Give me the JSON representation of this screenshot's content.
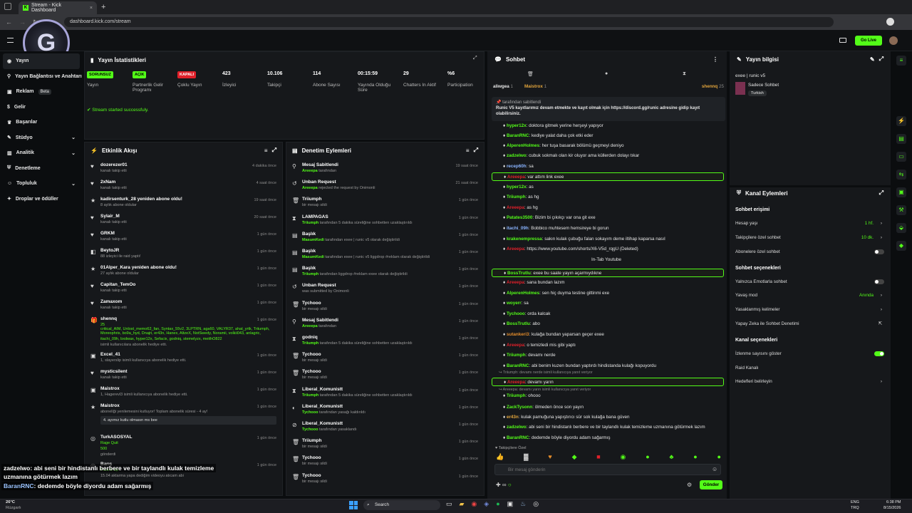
{
  "browser": {
    "tab_title": "Stream - Kick Dashboard",
    "url": "dashboard.kick.com/stream",
    "new_tab": "+"
  },
  "topbar": {
    "go_live": "Go Live"
  },
  "sidebar": {
    "items": [
      {
        "label": "Yayın"
      },
      {
        "label": "Yayın Bağlantısı ve Anahtarı"
      },
      {
        "label": "Reklam",
        "badge": "Beta"
      },
      {
        "label": "Gelir"
      },
      {
        "label": "Başarılar"
      },
      {
        "label": "Stüdyo"
      },
      {
        "label": "Analitik"
      },
      {
        "label": "Denetleme"
      },
      {
        "label": "Topluluk"
      },
      {
        "label": "Droplar ve ödüller"
      }
    ]
  },
  "stats": {
    "title": "Yayın İstatistikleri",
    "items": [
      {
        "value": "SORUNSUZ",
        "label": "Yayın",
        "kind": "badge-green"
      },
      {
        "value": "AÇIK",
        "label": "Partnerlik Gelir Programı",
        "kind": "badge-green"
      },
      {
        "value": "KAPALI",
        "label": "Çoklu Yayın",
        "kind": "badge-red"
      },
      {
        "value": "423",
        "label": "İzleyici"
      },
      {
        "value": "10.106",
        "label": "Takipçi"
      },
      {
        "value": "114",
        "label": "Abone Sayısı"
      },
      {
        "value": "00:15:59",
        "label": "Yayında Olduğu Süre"
      },
      {
        "value": "29",
        "label": "Chatters In Aktif"
      },
      {
        "value": "%6",
        "label": "Participation"
      }
    ],
    "notice": "Stream started successfuly."
  },
  "activity": {
    "title": "Etkinlik Akışı",
    "rows": [
      {
        "name": "dozerezer01",
        "sub": "kanalı takip etti",
        "time": "4 dakika önce",
        "icon": "♥"
      },
      {
        "name": "2xNam",
        "sub": "kanalı takip etti",
        "time": "4 saat önce",
        "icon": "♥"
      },
      {
        "name": "kadirsenturk_28 yeniden abone oldu!",
        "sub": "8 aylık abone oldular",
        "time": "19 saat önce",
        "icon": "★"
      },
      {
        "name": "Sylair_M",
        "sub": "kanalı takip etti",
        "time": "20 saat önce",
        "icon": "♥"
      },
      {
        "name": "GRKM",
        "sub": "kanalı takip etti",
        "time": "1 gün önce",
        "icon": "♥"
      },
      {
        "name": "BeytoJR",
        "sub": "88 izleyici ile raid yaptı!",
        "time": "1 gün önce",
        "icon": "◧"
      },
      {
        "name": "01Alper_Kara yeniden abone oldu!",
        "sub": "27 aylık abone oldular",
        "time": "1 gün önce",
        "icon": "★"
      },
      {
        "name": "Capitan_TemOo",
        "sub": "kanalı takip etti",
        "time": "1 gün önce",
        "icon": "♥"
      },
      {
        "name": "Zamaxom",
        "sub": "kanalı takip etti",
        "time": "1 gün önce",
        "icon": "♥"
      }
    ],
    "gift": {
      "name": "shennq",
      "time": "1 gün önce",
      "count": "25",
      "list1": "critical_AIM, Unlost_memo62_fan, Syntax_55v2, 3LPTRN, aga60, VALYR37, ahat_yrtk, Triiumph, Moreophris, bo9a_hyd, Dnajri, er43n, Hanex, AltzeX, NotSwedy, Noramii, volkii043, anlagric,",
      "list2": "itachi_09h, bxdwax, hyper12x, Sefacix, godniq, stemelyzx, meithO822",
      "list3": "isimli kullanıcılara abonelik hediye etti."
    },
    "rows2": [
      {
        "name": "Excel_41",
        "sub": "1, slayerslip isimli kullanıcıya abonelik hediye etti.",
        "time": "1 gün önce",
        "icon": "▣"
      },
      {
        "name": "mysticsilent",
        "sub": "kanalı takip etti",
        "time": "1 gün önce",
        "icon": "♥"
      },
      {
        "name": "Maistrox",
        "sub": "1, Hagerevl3 isimli kullanıcıya abonelik hediye etti.",
        "time": "1 gün önce",
        "icon": "▣"
      }
    ],
    "resub": {
      "name": "Maistrox",
      "sub": "aboneliği yenilemesini kutluyor! Toplam abonelik süresi - 4 ay!",
      "msg": "4. ayımız kutlu olmasın ms bee",
      "time": "1 gün önce"
    },
    "kicks": {
      "name": "TurkASOSYAL",
      "line1": "Rage Quit",
      "line2": "500",
      "line3": "gönderdi",
      "time": "1 gün önce"
    },
    "last": {
      "name": "Barış",
      "sub": "Pack It Up",
      "time": "1 gün önce",
      "extra": "15.04 aktarma yapa dediğim videoyu atıcam abi"
    }
  },
  "mod": {
    "title": "Denetim Eylemleri",
    "rows": [
      {
        "name": "Mesaj Sabitlendi",
        "actor": "Areeepa",
        "sub": "tarafından",
        "time": "19 saat önce",
        "icon": "⚲"
      },
      {
        "name": "Unban Request",
        "actor": "Areeepa",
        "sub": "rejected the request by Onimonli",
        "time": "21 saat önce",
        "icon": "↺"
      },
      {
        "name": "Triiumph",
        "actor": "",
        "sub": "bir mesajı sildi",
        "time": "1 gün önce",
        "icon": "🗑"
      },
      {
        "name": "LAMPAGAS",
        "actor": "Triiumph",
        "sub": "tarafından 5 dakika süreliğine sohbetten uzaklaştırıldı",
        "time": "1 gün önce",
        "icon": "⧗"
      },
      {
        "name": "Başlık",
        "actor": "MasumKedi",
        "sub": "tarafından exee | runic v5 olarak değiştirildi",
        "time": "1 gün önce",
        "icon": "▤"
      },
      {
        "name": "Başlık",
        "actor": "MasumKedi",
        "sub": "tarafından exee | runic v5 liggdrop #reklam olarak değiştirildi",
        "time": "1 gün önce",
        "icon": "▤"
      },
      {
        "name": "Başlık",
        "actor": "Triiumph",
        "sub": "tarafından liggdrop #reklam exee olarak değiştirildi",
        "time": "1 gün önce",
        "icon": "▤"
      },
      {
        "name": "Unban Request",
        "actor": "",
        "sub": "was submitted by Onimonli",
        "time": "1 gün önce",
        "icon": "↺"
      },
      {
        "name": "Tychooo",
        "actor": "",
        "sub": "bir mesajı sildi",
        "time": "1 gün önce",
        "icon": "🗑"
      },
      {
        "name": "Mesaj Sabitlendi",
        "actor": "Areeepa",
        "sub": "tarafından",
        "time": "1 gün önce",
        "icon": "⚲"
      },
      {
        "name": "godniq",
        "actor": "Triiumph",
        "sub": "tarafından 5 dakika süreliğine sohbetten uzaklaştırıldı",
        "time": "1 gün önce",
        "icon": "⧗"
      },
      {
        "name": "Tychooo",
        "actor": "",
        "sub": "bir mesajı sildi",
        "time": "1 gün önce",
        "icon": "🗑"
      },
      {
        "name": "Tychooo",
        "actor": "",
        "sub": "bir mesajı sildi",
        "time": "1 gün önce",
        "icon": "🗑"
      },
      {
        "name": "Liberal_Komunistt",
        "actor": "Triiumph",
        "sub": "tarafından 5 dakika süreliğine sohbetten uzaklaştırıldı",
        "time": "1 gün önce",
        "icon": "⧗"
      },
      {
        "name": "Liberal_Komunistt",
        "actor": "Tychooo",
        "sub": "tarafından yasağı kaldırıldı",
        "time": "1 gün önce",
        "icon": "◐"
      },
      {
        "name": "Liberal_Komunistt",
        "actor": "Tychooo",
        "sub": "tarafından yasaklandı",
        "time": "1 gün önce",
        "icon": "⊘"
      },
      {
        "name": "Triiumph",
        "actor": "",
        "sub": "bir mesajı sildi",
        "time": "1 gün önce",
        "icon": "🗑"
      },
      {
        "name": "Tychooo",
        "actor": "",
        "sub": "bir mesajı sildi",
        "time": "1 gün önce",
        "icon": "🗑"
      },
      {
        "name": "Tychooo",
        "actor": "",
        "sub": "bir mesajı sildi",
        "time": "1 gün önce",
        "icon": "🗑"
      }
    ]
  },
  "chat": {
    "title": "Sohbet",
    "top_users": [
      {
        "name": "aliwgea",
        "n": "1"
      },
      {
        "name": "Maistrox",
        "n": "1"
      },
      {
        "name": "shennq",
        "n": "25"
      }
    ],
    "pinned_by": "tarafından sabitlendi",
    "pinned": "Runic V5 kayıtlarımız devam etmekte ve kayıt olmak için https://discord.gg/runic adresine gidip kayıt olabilirsiniz.",
    "messages": [
      {
        "user": "hyper12x",
        "text": "doktora gitmek yerine herşeyi yapıyor",
        "hl": false
      },
      {
        "user": "BaranRNC",
        "text": "kediye yalat daha çok etki eder",
        "hl": false
      },
      {
        "user": "AlperenHolmes",
        "text": "her tuşa basarak bölümü geçmeyi deniyo",
        "hl": false
      },
      {
        "user": "zadzelwo",
        "text": "cubuk sokmalı olan kir oluyor ama küllerden dolayı tıkar",
        "hl": false
      },
      {
        "user": "recep60h",
        "text": "sa",
        "hl": false
      },
      {
        "user": "Areeepa",
        "text": "var attım link exee",
        "hl": true
      },
      {
        "user": "hyper12x",
        "text": "as",
        "hl": false
      },
      {
        "user": "Triiumph",
        "text": "as hg",
        "hl": false
      },
      {
        "user": "Areeepa",
        "text": "as hg",
        "hl": false
      },
      {
        "user": "Patates3500",
        "text": "Bizim bi çıkıkçı var ona git exe",
        "hl": false
      },
      {
        "user": "itachi_09h",
        "text": "Bobbico muhtesem hemsireye bi gorun",
        "hl": false
      },
      {
        "user": "krakenempressa",
        "text": "sakın kulak çubuğu falan sokayım deme iltihap kaparsa nasıl",
        "hl": false
      },
      {
        "user": "Areeepa",
        "text": "https://www.youtube.com/shorts/X6-V5d_rqgU (Deleted)",
        "hl": false
      },
      {
        "user": "",
        "text": "In-Tab Youtube",
        "hl": false
      },
      {
        "user": "BossTrutlu",
        "text": "exee bu saate yayın açarmıydıkne",
        "hl": true
      },
      {
        "user": "Areeepa",
        "text": "sana bundan lazım",
        "hl": false
      },
      {
        "user": "AlperenHolmes",
        "text": "sen hiç duyma testine gittinmi exe",
        "hl": false
      },
      {
        "user": "woyerr",
        "text": "sa",
        "hl": false
      },
      {
        "user": "Tychooo",
        "text": "orda kalcak",
        "hl": false
      },
      {
        "user": "BossTrutlu",
        "text": "abo",
        "hl": false
      },
      {
        "user": "sutankeri3",
        "text": "kulağa bundan yaparsan geçer exee",
        "hl": false
      },
      {
        "user": "Areeepa",
        "text": "o temizledi mis gibi yaptı",
        "hl": false
      },
      {
        "user": "Triiumph",
        "text": "devamı nerde",
        "hl": false
      },
      {
        "user": "BaranRNC",
        "text": "abi benim kuzen bundan yaptırdı hindistanda kulağı kopuyordu",
        "hl": false
      },
      {
        "user": "Areeepa",
        "text": "devamı yarın",
        "hl": true
      },
      {
        "user": "Triiumph",
        "text": "ohooo",
        "hl": false
      },
      {
        "user": "ZackTysonn",
        "text": "ölmeden önce son yayın",
        "hl": false
      },
      {
        "user": "er43n",
        "text": "kulak pamuğuna yapıştırıcı sür sok kulağa bana güven",
        "hl": false
      },
      {
        "user": "zadzelwo",
        "text": "abi seni bir hindistanlı berbere ve bir taylandlı kulak temizleme uzmanına götürmek lazım",
        "hl": false
      },
      {
        "user": "BaranRNC",
        "text": "dedemde böyle diyordu adam sağarmış",
        "hl": false
      }
    ],
    "reply1": "↪ Triiumph: devamı nerde isimli kullanıcıya yanıt veriyor",
    "reply2": "↪ Areeepa: devamı yarın isimli kullanıcıya yanıt veriyor",
    "followers_only": "♥ Takipçilere Özel",
    "placeholder": "Bir mesaj gönderin",
    "send": "Gönder"
  },
  "info": {
    "title": "Yayın bilgisi",
    "stream_title": "exee | runic v5",
    "mode": "Sadece Sohbet",
    "lang": "Turkish"
  },
  "channel": {
    "title": "Kanal Eylemleri",
    "access_head": "Sohbet erişimi",
    "account_age": {
      "label": "Hesap yaşı",
      "value": "1 hf."
    },
    "follower_only": {
      "label": "Takipçilere özel sohbet",
      "value": "10 dk."
    },
    "sub_only": "Abonelere özel sohbet",
    "opts_head": "Sohbet seçenekleri",
    "emote_only": "Yalnızca Emotlarla sohbet",
    "slow": {
      "label": "Yavaş mod",
      "value": "Anında"
    },
    "banned_words": "Yasaklanmış kelimeler",
    "ai_mod": "Yapay Zeka ile Sohbet Denetimi",
    "ch_head": "Kanal seçenekleri",
    "viewer_count": "İzlenme sayısını göster",
    "raid": "Raid Kanalı",
    "host": "Hedefleri belirleyin"
  },
  "overlay": {
    "line1_user": "zadzelwo",
    "line1": ": abi seni bir hindistanlı berbere ve bir taylandlı kulak temizleme",
    "line1b": "uzmanına götürmek lazım",
    "line2_user": "BaranRNC",
    "line2": ": dedemde böyle diyordu adam sağarmış"
  },
  "taskbar": {
    "temp": "26°C",
    "weather": "Rüzgarlı",
    "search": "Search",
    "lang": "ENG",
    "kb": "TRQ",
    "time": "6:38 PM",
    "date": "8/15/2026"
  },
  "colors": {
    "accent": "#53fc18",
    "panel": "#16181b",
    "bg": "#0b0d0f",
    "red": "#e0202a"
  }
}
